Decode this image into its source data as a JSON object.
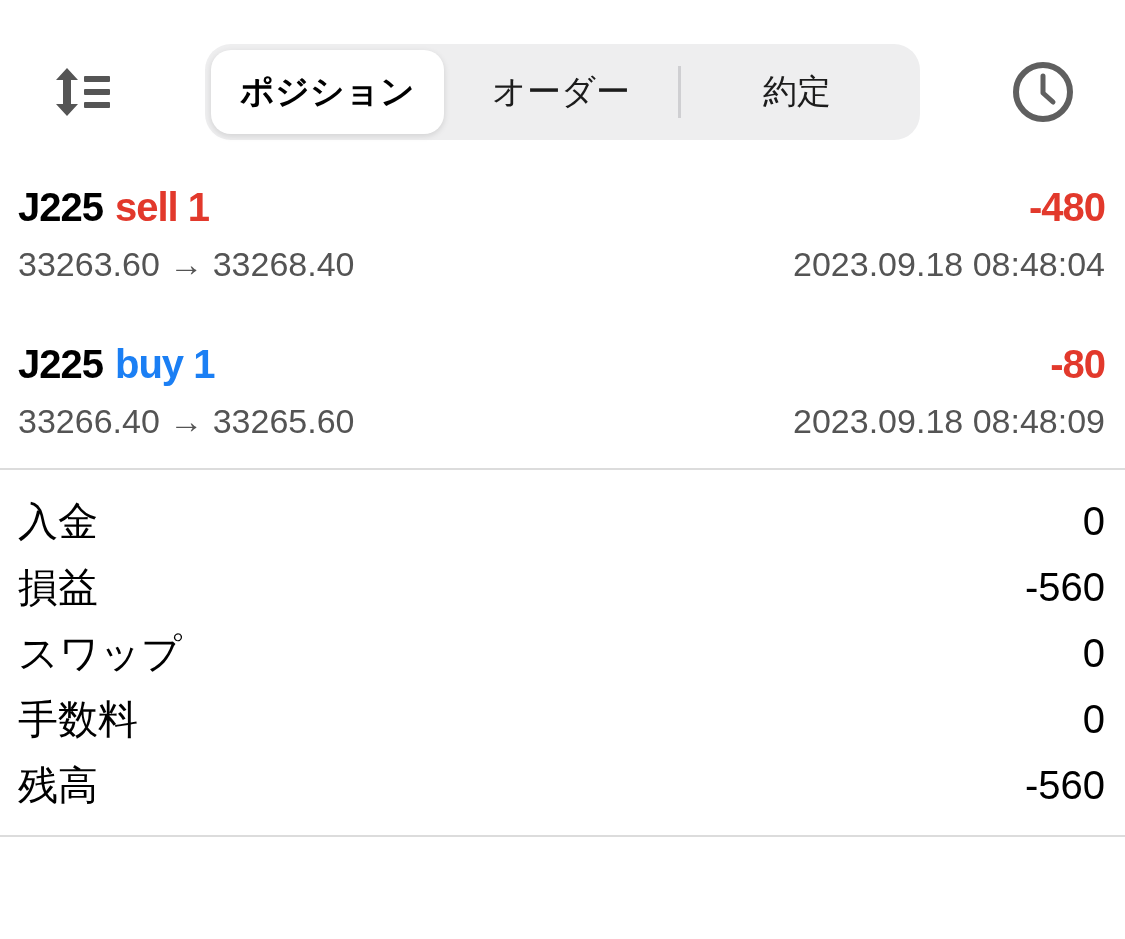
{
  "toolbar": {
    "segments": [
      {
        "label": "ポジション",
        "selected": true
      },
      {
        "label": "オーダー",
        "selected": false
      },
      {
        "label": "約定",
        "selected": false
      }
    ]
  },
  "trades": [
    {
      "symbol": "J225",
      "order": "sell 1",
      "kind": "sell",
      "profit": "-480",
      "loss": true,
      "prices": "33263.60 → 33268.40",
      "time": "2023.09.18 08:48:04"
    },
    {
      "symbol": "J225",
      "order": "buy 1",
      "kind": "buy",
      "profit": "-80",
      "loss": true,
      "prices": "33266.40 → 33265.60",
      "time": "2023.09.18 08:48:09"
    }
  ],
  "summary": [
    {
      "label": "入金",
      "value": "0"
    },
    {
      "label": "損益",
      "value": "-560"
    },
    {
      "label": "スワップ",
      "value": "0"
    },
    {
      "label": "手数料",
      "value": "0"
    },
    {
      "label": "残高",
      "value": "-560"
    }
  ]
}
